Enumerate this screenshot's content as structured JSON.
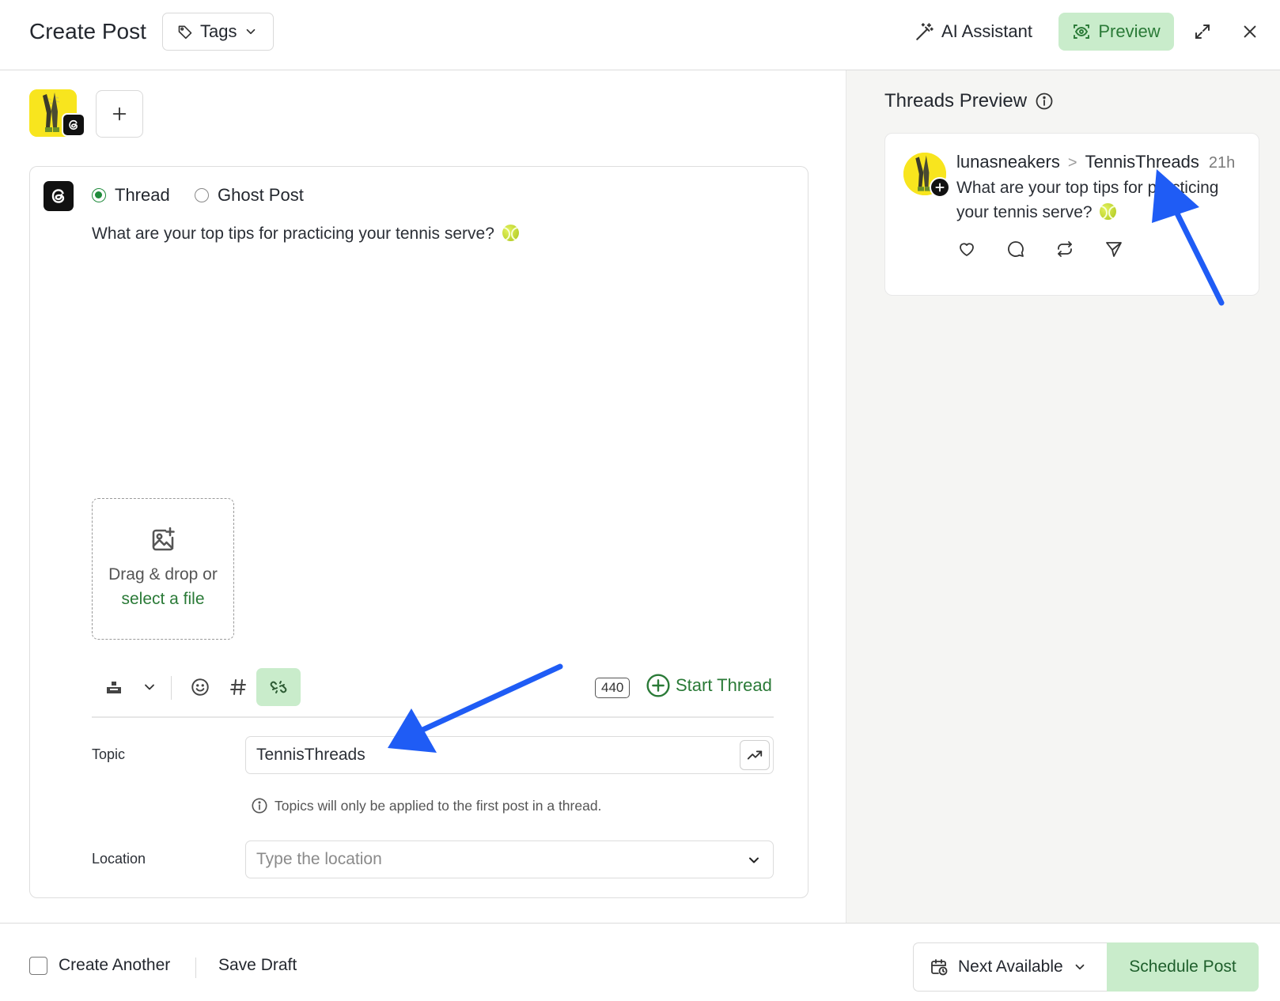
{
  "header": {
    "title": "Create Post",
    "tags_label": "Tags",
    "ai_assistant_label": "AI Assistant",
    "preview_label": "Preview"
  },
  "editor": {
    "post_types": [
      {
        "label": "Thread",
        "selected": true
      },
      {
        "label": "Ghost Post",
        "selected": false
      }
    ],
    "post_text": "What are your top tips for practicing your tennis serve?",
    "dropzone": {
      "line1": "Drag & drop or",
      "link": "select a file"
    },
    "char_count": "440",
    "start_thread_label": "Start Thread",
    "topic": {
      "label": "Topic",
      "value": "TennisThreads",
      "hint": "Topics will only be applied to the first post in a thread."
    },
    "location": {
      "label": "Location",
      "placeholder": "Type the location"
    }
  },
  "preview": {
    "title": "Threads Preview",
    "username": "lunasneakers",
    "separator": ">",
    "topic": "TennisThreads",
    "time": "21h",
    "text": "What are your top tips for practicing your tennis serve?"
  },
  "footer": {
    "create_another_label": "Create Another",
    "save_draft_label": "Save Draft",
    "next_available_label": "Next Available",
    "schedule_label": "Schedule Post"
  },
  "colors": {
    "accent_green": "#2a7a37",
    "accent_green_bg": "#c9eccb",
    "annotation_arrow": "#1f5cf5",
    "avatar_yellow": "#f8e51e"
  },
  "icons": {
    "tags": "tag-icon",
    "ai": "magic-wand-icon",
    "preview": "eye-scan-icon",
    "expand": "expand-icon",
    "close": "close-icon",
    "threads": "threads-logo-icon",
    "image": "image-add-icon",
    "trend": "trend-up-icon",
    "info": "info-icon"
  }
}
